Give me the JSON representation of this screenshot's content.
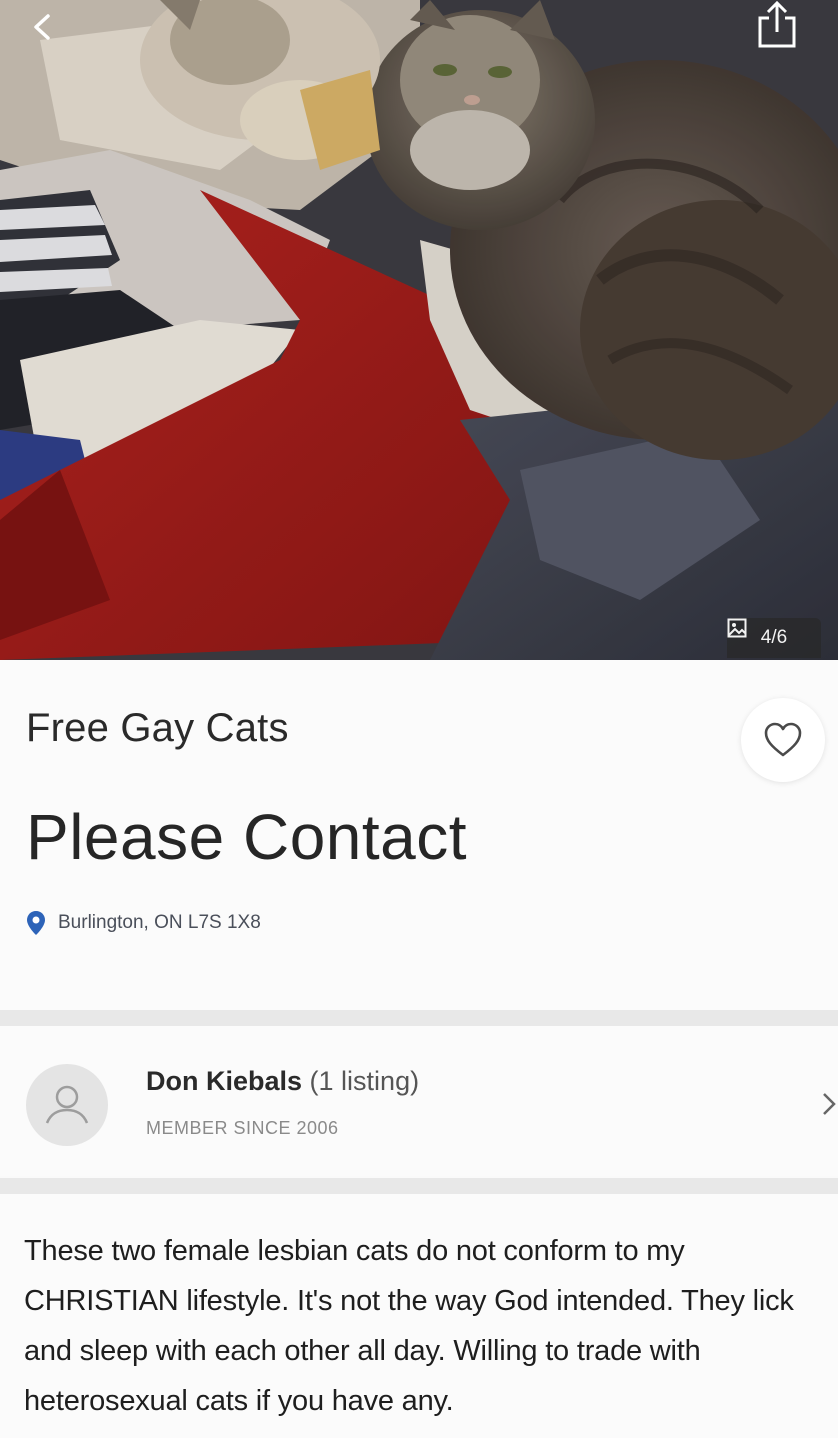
{
  "photo": {
    "counter": "4/6",
    "icons": {
      "back": "chevron-left-icon",
      "share": "share-icon",
      "gallery": "image-icon"
    }
  },
  "listing": {
    "title": "Free Gay Cats",
    "price": "Please Contact",
    "location": "Burlington, ON L7S 1X8",
    "icons": {
      "favorite": "heart-icon",
      "location": "location-pin-icon"
    },
    "colors": {
      "pin": "#2d63b8"
    }
  },
  "seller": {
    "name": "Don Kiebals",
    "listing_count": "(1 listing)",
    "member_since": "MEMBER SINCE 2006",
    "icons": {
      "avatar": "user-icon",
      "chevron": "chevron-right-icon"
    }
  },
  "description": {
    "text": "These two female lesbian cats do not conform to my CHRISTIAN lifestyle. It's not the way God intended. They lick and sleep with each other all day. Willing to trade with heterosexual cats if you have any."
  }
}
